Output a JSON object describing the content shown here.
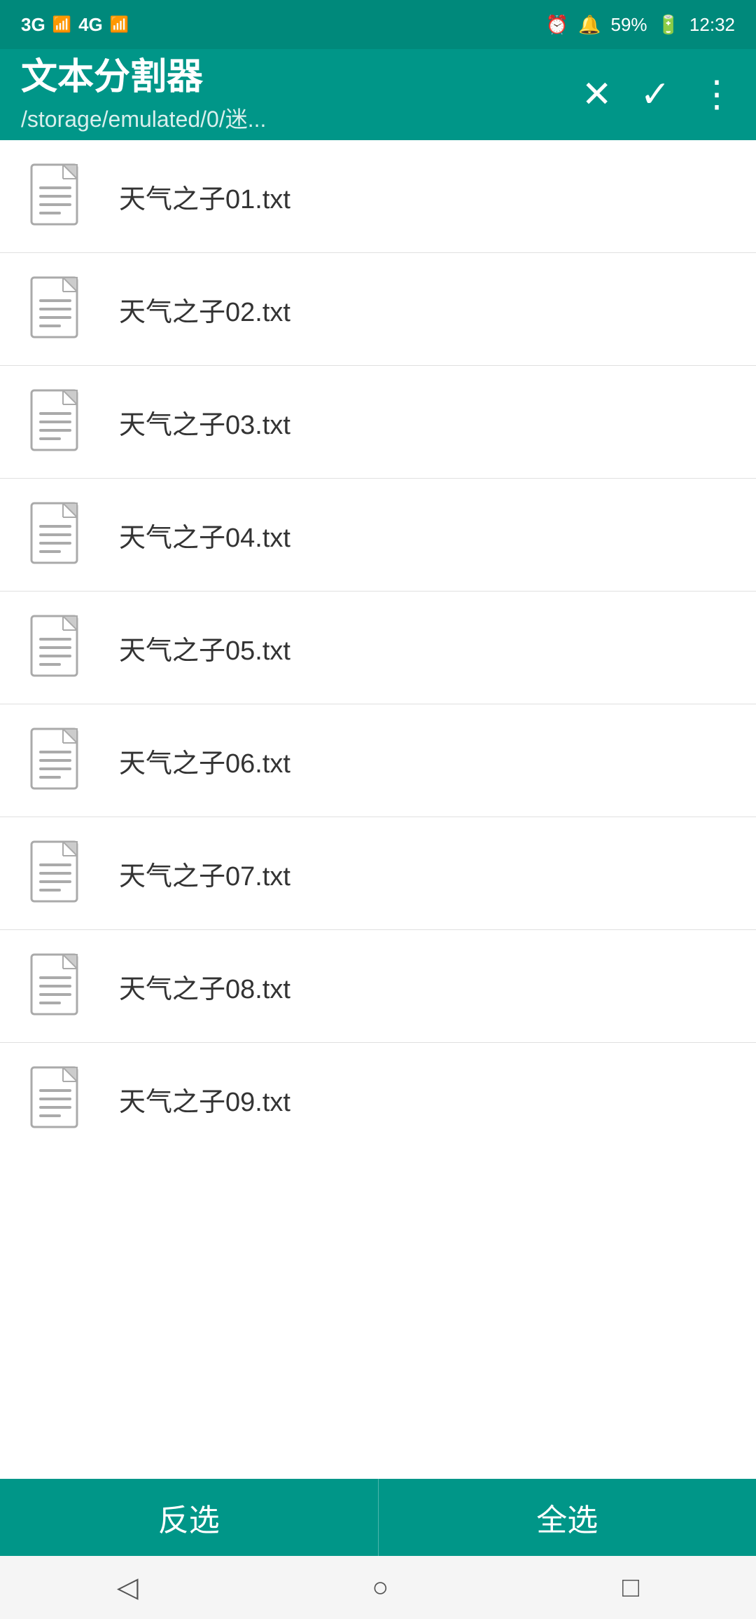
{
  "statusBar": {
    "network1": "3G",
    "network2": "4G",
    "alarmIcon": "⏰",
    "bellIcon": "🔔",
    "battery": "59%",
    "time": "12:32"
  },
  "appBar": {
    "title": "文本分割器",
    "subtitle": "/storage/emulated/0/迷...",
    "closeIcon": "✕",
    "checkIcon": "✓",
    "moreIcon": "⋮"
  },
  "files": [
    {
      "name": "天气之子01.txt"
    },
    {
      "name": "天气之子02.txt"
    },
    {
      "name": "天气之子03.txt"
    },
    {
      "name": "天气之子04.txt"
    },
    {
      "name": "天气之子05.txt"
    },
    {
      "name": "天气之子06.txt"
    },
    {
      "name": "天气之子07.txt"
    },
    {
      "name": "天气之子08.txt"
    },
    {
      "name": "天气之子09.txt"
    }
  ],
  "bottomBar": {
    "invertLabel": "反选",
    "selectAllLabel": "全选"
  },
  "navBar": {
    "backIcon": "◁",
    "homeIcon": "○",
    "recentIcon": "□"
  }
}
